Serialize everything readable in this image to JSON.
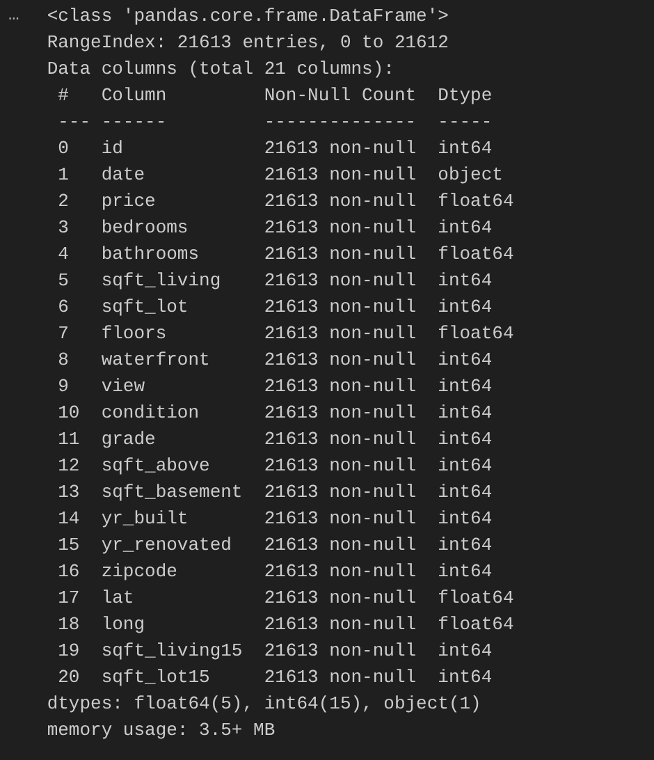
{
  "output_menu": "…",
  "header_lines": [
    "<class 'pandas.core.frame.DataFrame'>",
    "RangeIndex: 21613 entries, 0 to 21612",
    "Data columns (total 21 columns):"
  ],
  "columns": [
    "#",
    "Column",
    "Non-Null Count",
    "Dtype"
  ],
  "separators": [
    "---",
    "------",
    "--------------",
    "-----"
  ],
  "rows": [
    {
      "index": "0",
      "column": "id",
      "count": "21613 non-null",
      "dtype": "int64"
    },
    {
      "index": "1",
      "column": "date",
      "count": "21613 non-null",
      "dtype": "object"
    },
    {
      "index": "2",
      "column": "price",
      "count": "21613 non-null",
      "dtype": "float64"
    },
    {
      "index": "3",
      "column": "bedrooms",
      "count": "21613 non-null",
      "dtype": "int64"
    },
    {
      "index": "4",
      "column": "bathrooms",
      "count": "21613 non-null",
      "dtype": "float64"
    },
    {
      "index": "5",
      "column": "sqft_living",
      "count": "21613 non-null",
      "dtype": "int64"
    },
    {
      "index": "6",
      "column": "sqft_lot",
      "count": "21613 non-null",
      "dtype": "int64"
    },
    {
      "index": "7",
      "column": "floors",
      "count": "21613 non-null",
      "dtype": "float64"
    },
    {
      "index": "8",
      "column": "waterfront",
      "count": "21613 non-null",
      "dtype": "int64"
    },
    {
      "index": "9",
      "column": "view",
      "count": "21613 non-null",
      "dtype": "int64"
    },
    {
      "index": "10",
      "column": "condition",
      "count": "21613 non-null",
      "dtype": "int64"
    },
    {
      "index": "11",
      "column": "grade",
      "count": "21613 non-null",
      "dtype": "int64"
    },
    {
      "index": "12",
      "column": "sqft_above",
      "count": "21613 non-null",
      "dtype": "int64"
    },
    {
      "index": "13",
      "column": "sqft_basement",
      "count": "21613 non-null",
      "dtype": "int64"
    },
    {
      "index": "14",
      "column": "yr_built",
      "count": "21613 non-null",
      "dtype": "int64"
    },
    {
      "index": "15",
      "column": "yr_renovated",
      "count": "21613 non-null",
      "dtype": "int64"
    },
    {
      "index": "16",
      "column": "zipcode",
      "count": "21613 non-null",
      "dtype": "int64"
    },
    {
      "index": "17",
      "column": "lat",
      "count": "21613 non-null",
      "dtype": "float64"
    },
    {
      "index": "18",
      "column": "long",
      "count": "21613 non-null",
      "dtype": "float64"
    },
    {
      "index": "19",
      "column": "sqft_living15",
      "count": "21613 non-null",
      "dtype": "int64"
    },
    {
      "index": "20",
      "column": "sqft_lot15",
      "count": "21613 non-null",
      "dtype": "int64"
    }
  ],
  "footer_lines": [
    "dtypes: float64(5), int64(15), object(1)",
    "memory usage: 3.5+ MB"
  ]
}
